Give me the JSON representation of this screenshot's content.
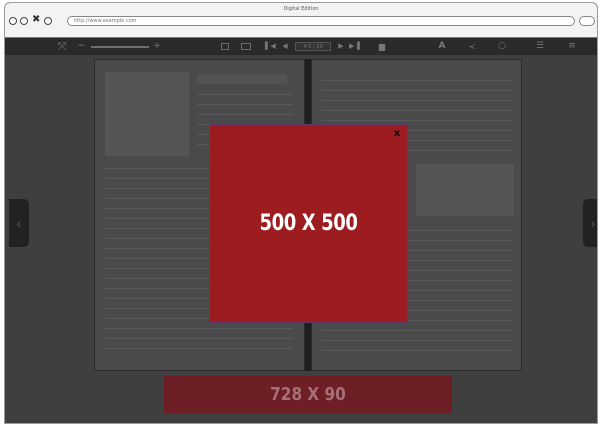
{
  "window": {
    "title": "Digital Edition",
    "url": "http://www.example.com"
  },
  "toolbar": {
    "zoom_out": "−",
    "zoom_in": "+",
    "page_readout": "4-5 / 20"
  },
  "ads": {
    "popup_label": "500 X 500",
    "close_label": "x",
    "banner_label": "728 X 90"
  },
  "colors": {
    "popup_ad": "#9c1c1f",
    "banner_ad": "#6d1f25",
    "reader_bg": "#3f3f3f"
  },
  "icons": [
    "fullscreen-icon",
    "zoom-slider",
    "single-page-icon",
    "double-page-icon",
    "first-page-icon",
    "prev-page-icon",
    "next-page-icon",
    "last-page-icon",
    "print-icon",
    "text-icon",
    "share-icon",
    "search-icon",
    "thumbnails-icon",
    "menu-icon"
  ]
}
